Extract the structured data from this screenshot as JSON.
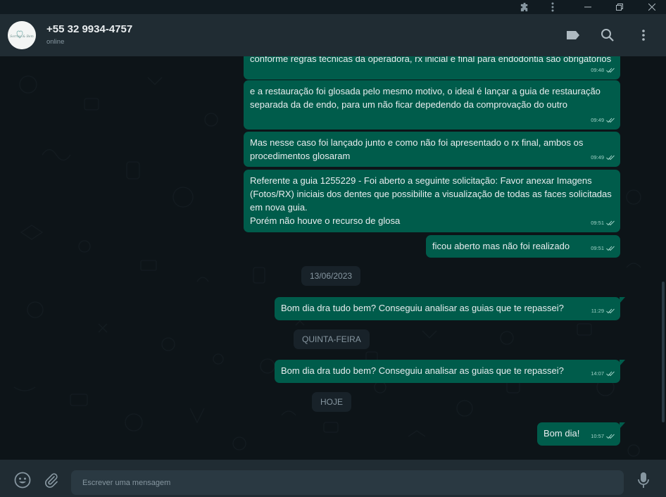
{
  "header": {
    "contact_name": "+55 32 9934-4757",
    "status": "online",
    "avatar_text": "Sorriso & Bem"
  },
  "messages": [
    {
      "text": "conforme regras técnicas da operadora, rx inicial e final para endodontia são obrigatorios",
      "time": "09:48"
    },
    {
      "text": "e a restauração foi glosada pelo mesmo motivo, o ideal é lançar a guia de restauração separada da de endo, para um não ficar depedendo da comprovação do outro",
      "time": "09:49"
    },
    {
      "text": "Mas nesse caso foi lançado junto e como não foi apresentado o rx final, ambos os procedimentos glosaram",
      "time": "09:49"
    },
    {
      "text": "Referente a guia 1255229 - Foi aberto a seguinte solicitação: Favor anexar Imagens (Fotos/RX) iniciais dos dentes que possibilite a visualização de todas as faces solicitadas em nova guia.\nPorém não houve o recurso de glosa",
      "time": "09:51"
    },
    {
      "text": "ficou aberto mas não foi realizado",
      "time": "09:51"
    },
    {
      "text": "Bom dia dra tudo bem? Conseguiu analisar as guias que te repassei?",
      "time": "11:29"
    },
    {
      "text": "Bom dia dra tudo bem? Conseguiu analisar as guias que te repassei?",
      "time": "14:07"
    },
    {
      "text": "Bom dia!",
      "time": "10:57"
    }
  ],
  "dates": {
    "d1": "13/06/2023",
    "d2": "QUINTA-FEIRA",
    "d3": "HOJE"
  },
  "composer": {
    "placeholder": "Escrever uma mensagem"
  },
  "colors": {
    "outgoing_bubble": "#005c4b",
    "header": "#202c33",
    "chat_bg": "#0d1418",
    "read_ticks": "#9fd1c6"
  },
  "icons": [
    "puzzle-icon",
    "kebab-icon",
    "minimize-icon",
    "restore-icon",
    "close-icon",
    "label-icon",
    "search-icon",
    "menu-icon",
    "emoji-icon",
    "attach-icon",
    "mic-icon"
  ]
}
